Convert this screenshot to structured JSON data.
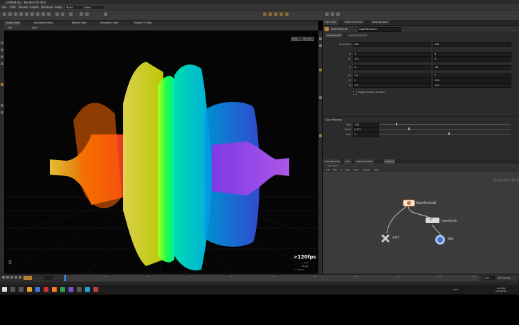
{
  "app": {
    "window_title": "untitled.hip - Houdini FX 18.0",
    "menus": [
      "File",
      "Edit",
      "Render",
      "Assets",
      "Windows",
      "Help"
    ],
    "desktop_label": "Build",
    "main_label": "Main"
  },
  "left_tabs": [
    "Scene View",
    "Animation Editor",
    "Render View",
    "Composite View",
    "Motion FX View"
  ],
  "viewport": {
    "path": "obj",
    "geo_node": "geo1",
    "camera_label": "No cam",
    "persp_label": "Persp",
    "fps": ">120fps",
    "stats": [
      "1 prim",
      "80 pts",
      "2.3M pts"
    ]
  },
  "right_tabs": [
    "Tree View",
    "Material Palette",
    "Asset Browser"
  ],
  "parm_tabs": [
    "Parameters",
    "Geometry Spreadsheet"
  ],
  "node": {
    "type_label": "Superformula",
    "name": "superformula1",
    "tabs": [
      "Superformula",
      "Superformula 3D"
    ]
  },
  "params": [
    {
      "label": "Resolution",
      "v1": "200",
      "v2": "200"
    },
    {
      "label": "m",
      "v1": "3",
      "v2": "6"
    },
    {
      "label": "n1",
      "v1": "-8.5",
      "v2": "8"
    },
    {
      "label": "a",
      "v1": "3",
      "v2": "-85"
    },
    {
      "label": "n2",
      "v1": "1.5",
      "v2": "2"
    },
    {
      "label": "n3",
      "v1": "1",
      "v2": "0.32"
    },
    {
      "label": "b",
      "v1": "1.3",
      "v2": "-0.3"
    }
  ],
  "toggle_label": "Toggle Curves / Surface",
  "color_section": {
    "title": "Color Mapping",
    "params": [
      {
        "label": "Freq",
        "value": "1.55"
      },
      {
        "label": "Offset",
        "value": "0.132"
      },
      {
        "label": "Amp",
        "value": "1"
      }
    ]
  },
  "net_tabs": [
    "Scene Browser",
    "Help",
    "Material Palette",
    "network"
  ],
  "net_path": "obj / geo1",
  "net_menus": [
    "Add",
    "Edit",
    "Go",
    "View",
    "Tools",
    "Layout",
    "Help"
  ],
  "net_context": "Geometry",
  "nodes": [
    {
      "label": "Superformula1"
    },
    {
      "label": "transform1"
    },
    {
      "label": "null1"
    },
    {
      "label": "file1"
    }
  ],
  "timeline": {
    "start": "1",
    "end": "240",
    "current": "1",
    "ticks": [
      "24",
      "48",
      "72",
      "96",
      "120",
      "144",
      "168",
      "192",
      "216",
      "240"
    ],
    "key_label": "Auto Update"
  },
  "taskbar": {
    "time": "9:13 PM",
    "date": "12/1/2019",
    "temp": "24°F"
  },
  "colors": {
    "orange": "#ff7a00",
    "yellow": "#f5e600",
    "green": "#39ff14",
    "cyan": "#00e5ff",
    "blue": "#2e6bff",
    "purple": "#b040ff"
  }
}
